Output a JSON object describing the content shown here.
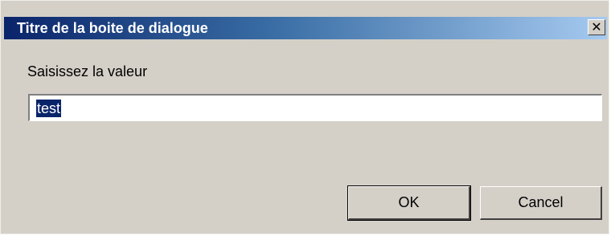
{
  "dialog": {
    "title": "Titre de la boite de dialogue",
    "close_icon": "close-icon",
    "prompt_label": "Saisissez la valeur",
    "input_value": "test",
    "ok_label": "OK",
    "cancel_label": "Cancel"
  },
  "colors": {
    "titlebar_start": "#0a246a",
    "titlebar_end": "#a6caf0",
    "dialog_face": "#d4d0c8",
    "selection": "#0a246a"
  }
}
